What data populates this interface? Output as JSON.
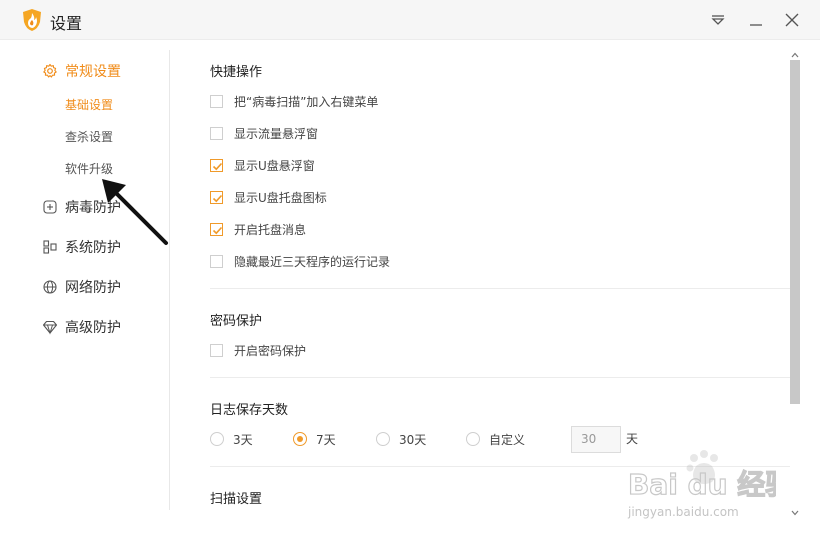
{
  "window": {
    "title": "设置"
  },
  "sidebar": {
    "groups": [
      {
        "label": "常规设置",
        "icon": "gear-icon",
        "active": true,
        "items": [
          {
            "label": "基础设置",
            "active": true
          },
          {
            "label": "查杀设置",
            "active": false
          },
          {
            "label": "软件升级",
            "active": false
          }
        ]
      },
      {
        "label": "病毒防护",
        "icon": "plus-square-icon"
      },
      {
        "label": "系统防护",
        "icon": "grid-icon"
      },
      {
        "label": "网络防护",
        "icon": "globe-icon"
      },
      {
        "label": "高级防护",
        "icon": "diamond-icon"
      }
    ]
  },
  "sections": {
    "quick": {
      "title": "快捷操作",
      "options": [
        {
          "label": "把“病毒扫描”加入右键菜单",
          "checked": false
        },
        {
          "label": "显示流量悬浮窗",
          "checked": false
        },
        {
          "label": "显示U盘悬浮窗",
          "checked": true
        },
        {
          "label": "显示U盘托盘图标",
          "checked": true
        },
        {
          "label": "开启托盘消息",
          "checked": true
        },
        {
          "label": "隐藏最近三天程序的运行记录",
          "checked": false
        }
      ]
    },
    "password": {
      "title": "密码保护",
      "options": [
        {
          "label": "开启密码保护",
          "checked": false
        }
      ]
    },
    "log": {
      "title": "日志保存天数",
      "radios": [
        {
          "label": "3天",
          "checked": false
        },
        {
          "label": "7天",
          "checked": true
        },
        {
          "label": "30天",
          "checked": false
        },
        {
          "label": "自定义",
          "checked": false
        }
      ],
      "custom_value": "30",
      "unit": "天"
    },
    "scan": {
      "title": "扫描设置"
    }
  },
  "watermark": {
    "brand": "Bai du 经验",
    "url": "jingyan.baidu.com"
  },
  "colors": {
    "accent": "#f08c1a",
    "titlebar_bg": "#f6f6f6"
  }
}
